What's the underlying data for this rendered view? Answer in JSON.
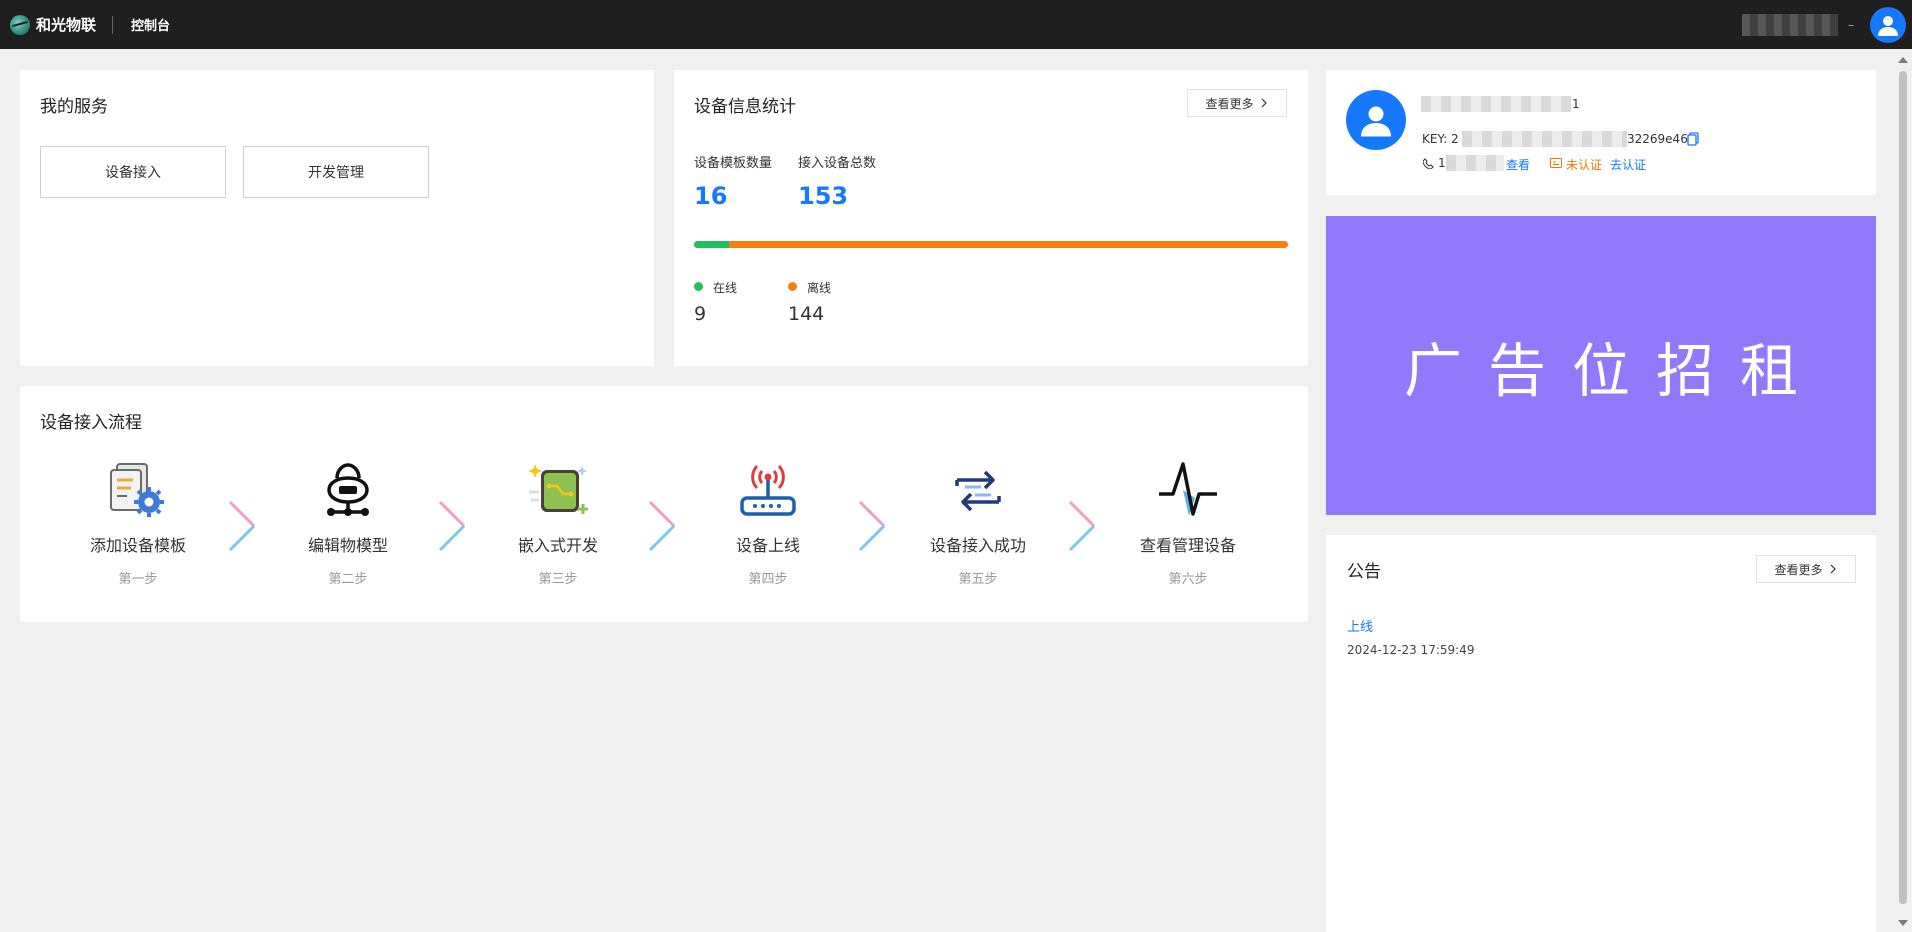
{
  "topbar": {
    "brand": "和光物联",
    "nav": "控制台",
    "user_suffix": "–"
  },
  "services": {
    "title": "我的服务",
    "buttons": [
      "设备接入",
      "开发管理"
    ]
  },
  "stats": {
    "title": "设备信息统计",
    "more": "查看更多",
    "template_label": "设备模板数量",
    "template_count": "16",
    "device_label": "接入设备总数",
    "device_count": "153",
    "online_label": "在线",
    "online_count": "9",
    "offline_label": "离线",
    "offline_count": "144",
    "online_fraction": 0.0588,
    "colors": {
      "online": "#1fbf5b",
      "offline": "#f67f12",
      "value": "#1677ff"
    }
  },
  "process": {
    "title": "设备接入流程",
    "steps": [
      {
        "title": "添加设备模板",
        "sub": "第一步",
        "icon": "template-gear-icon"
      },
      {
        "title": "编辑物模型",
        "sub": "第二步",
        "icon": "thing-model-icon"
      },
      {
        "title": "嵌入式开发",
        "sub": "第三步",
        "icon": "chip-board-icon"
      },
      {
        "title": "设备上线",
        "sub": "第四步",
        "icon": "router-signal-icon"
      },
      {
        "title": "设备接入成功",
        "sub": "第五步",
        "icon": "exchange-arrows-icon"
      },
      {
        "title": "查看管理设备",
        "sub": "第六步",
        "icon": "pulse-wave-icon"
      }
    ]
  },
  "profile": {
    "name_suffix": "1",
    "key_prefix": "KEY: 2",
    "key_suffix": "32269e46e",
    "phone_prefix": "1",
    "view_link": "查看",
    "unverified": "未认证",
    "verify_link": "去认证"
  },
  "ad": {
    "text": "广告位招租"
  },
  "notice": {
    "title": "公告",
    "more": "查看更多",
    "items": [
      {
        "title": "上线",
        "time": "2024-12-23 17:59:49"
      }
    ]
  }
}
